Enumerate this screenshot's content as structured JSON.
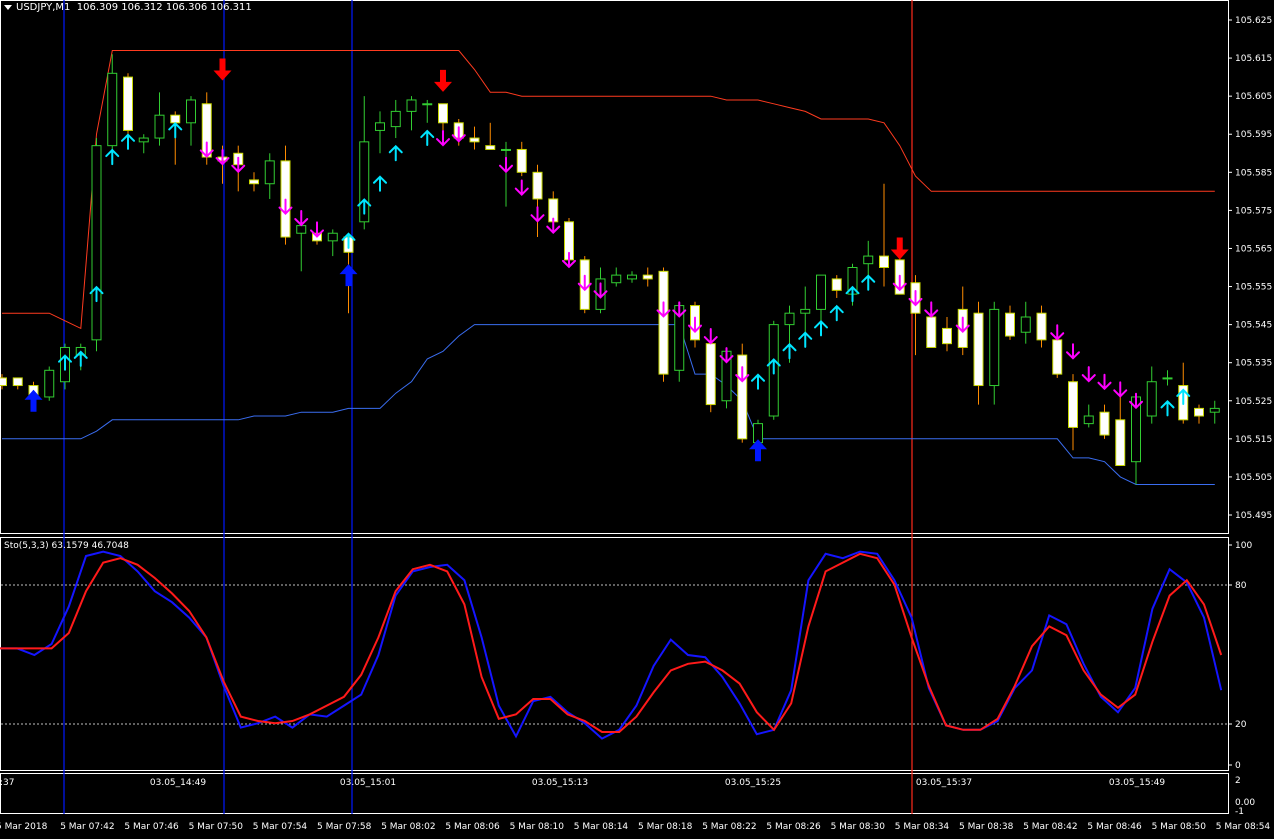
{
  "window": {
    "symbol_label": "USDJPY,M1",
    "ohlc_label": "106.309 106.312 106.306 106.311"
  },
  "indicator": {
    "label": "Sto(5,3,3) 63.1579 46.7048",
    "levels": [
      80,
      20
    ]
  },
  "colors": {
    "background": "#000000",
    "bull_candle": "#32cd32",
    "bear_candle": "#ffffff",
    "wick_up": "#32cd32",
    "wick_down": "#ff8c00",
    "upper_channel": "#ff3b1f",
    "lower_channel": "#3a6df0",
    "buy_arrow": "#00e5ff",
    "sell_arrow": "#ff00ff",
    "big_buy": "#0018ff",
    "big_sell": "#ff0000",
    "sto_main": "#1515ff",
    "sto_signal": "#ff1a1a"
  },
  "price_axis": [
    "105.625",
    "105.615",
    "105.605",
    "105.595",
    "105.585",
    "105.575",
    "105.565",
    "105.555",
    "105.545",
    "105.535",
    "105.525",
    "105.515",
    "105.505",
    "105.495"
  ],
  "sto_axis": [
    "100",
    "80",
    "20",
    "0"
  ],
  "bottom_axis": [
    "2",
    "0.00",
    "-1"
  ],
  "time_axis_top": [
    ":37",
    "03.05_14:49",
    "03.05_15:01",
    "03.05_15:13",
    "03.05_15:25",
    "03.05_15:37",
    "03.05_15:49"
  ],
  "time_axis_bottom": [
    "5 Mar 2018",
    "5 Mar 07:42",
    "5 Mar 07:46",
    "5 Mar 07:50",
    "5 Mar 07:54",
    "5 Mar 07:58",
    "5 Mar 08:02",
    "5 Mar 08:06",
    "5 Mar 08:10",
    "5 Mar 08:14",
    "5 Mar 08:18",
    "5 Mar 08:22",
    "5 Mar 08:26",
    "5 Mar 08:30",
    "5 Mar 08:34",
    "5 Mar 08:38",
    "5 Mar 08:42",
    "5 Mar 08:46",
    "5 Mar 08:50",
    "5 Mar 08:54"
  ],
  "candles": [
    {
      "o": 105.531,
      "h": 105.532,
      "l": 105.528,
      "c": 105.529
    },
    {
      "o": 105.531,
      "h": 105.531,
      "l": 105.528,
      "c": 105.529
    },
    {
      "o": 105.529,
      "h": 105.53,
      "l": 105.524,
      "c": 105.526
    },
    {
      "o": 105.526,
      "h": 105.534,
      "l": 105.525,
      "c": 105.533
    },
    {
      "o": 105.53,
      "h": 105.54,
      "l": 105.528,
      "c": 105.539
    },
    {
      "o": 105.537,
      "h": 105.54,
      "l": 105.533,
      "c": 105.539
    },
    {
      "o": 105.541,
      "h": 105.594,
      "l": 105.538,
      "c": 105.592
    },
    {
      "o": 105.592,
      "h": 105.616,
      "l": 105.588,
      "c": 105.611
    },
    {
      "o": 105.61,
      "h": 105.611,
      "l": 105.594,
      "c": 105.596
    },
    {
      "o": 105.593,
      "h": 105.595,
      "l": 105.59,
      "c": 105.594
    },
    {
      "o": 105.594,
      "h": 105.606,
      "l": 105.592,
      "c": 105.6
    },
    {
      "o": 105.6,
      "h": 105.601,
      "l": 105.587,
      "c": 105.598
    },
    {
      "o": 105.598,
      "h": 105.605,
      "l": 105.592,
      "c": 105.604
    },
    {
      "o": 105.603,
      "h": 105.606,
      "l": 105.587,
      "c": 105.589
    },
    {
      "o": 105.589,
      "h": 105.592,
      "l": 105.582,
      "c": 105.588
    },
    {
      "o": 105.59,
      "h": 105.592,
      "l": 105.58,
      "c": 105.587
    },
    {
      "o": 105.583,
      "h": 105.585,
      "l": 105.58,
      "c": 105.582
    },
    {
      "o": 105.582,
      "h": 105.59,
      "l": 105.578,
      "c": 105.588
    },
    {
      "o": 105.588,
      "h": 105.592,
      "l": 105.566,
      "c": 105.568
    },
    {
      "o": 105.569,
      "h": 105.573,
      "l": 105.559,
      "c": 105.571
    },
    {
      "o": 105.569,
      "h": 105.571,
      "l": 105.566,
      "c": 105.567
    },
    {
      "o": 105.567,
      "h": 105.57,
      "l": 105.563,
      "c": 105.569
    },
    {
      "o": 105.568,
      "h": 105.569,
      "l": 105.548,
      "c": 105.564
    },
    {
      "o": 105.572,
      "h": 105.605,
      "l": 105.57,
      "c": 105.593
    },
    {
      "o": 105.596,
      "h": 105.601,
      "l": 105.59,
      "c": 105.598
    },
    {
      "o": 105.597,
      "h": 105.604,
      "l": 105.594,
      "c": 105.601
    },
    {
      "o": 105.601,
      "h": 105.605,
      "l": 105.596,
      "c": 105.604
    },
    {
      "o": 105.603,
      "h": 105.604,
      "l": 105.598,
      "c": 105.603
    },
    {
      "o": 105.603,
      "h": 105.603,
      "l": 105.595,
      "c": 105.598
    },
    {
      "o": 105.598,
      "h": 105.599,
      "l": 105.592,
      "c": 105.594
    },
    {
      "o": 105.594,
      "h": 105.597,
      "l": 105.591,
      "c": 105.593
    },
    {
      "o": 105.592,
      "h": 105.598,
      "l": 105.591,
      "c": 105.591
    },
    {
      "o": 105.591,
      "h": 105.593,
      "l": 105.576,
      "c": 105.591
    },
    {
      "o": 105.591,
      "h": 105.593,
      "l": 105.584,
      "c": 105.585
    },
    {
      "o": 105.585,
      "h": 105.587,
      "l": 105.568,
      "c": 105.578
    },
    {
      "o": 105.578,
      "h": 105.58,
      "l": 105.571,
      "c": 105.572
    },
    {
      "o": 105.572,
      "h": 105.573,
      "l": 105.56,
      "c": 105.562
    },
    {
      "o": 105.562,
      "h": 105.563,
      "l": 105.548,
      "c": 105.549
    },
    {
      "o": 105.549,
      "h": 105.56,
      "l": 105.548,
      "c": 105.557
    },
    {
      "o": 105.556,
      "h": 105.56,
      "l": 105.555,
      "c": 105.558
    },
    {
      "o": 105.557,
      "h": 105.559,
      "l": 105.556,
      "c": 105.558
    },
    {
      "o": 105.558,
      "h": 105.56,
      "l": 105.555,
      "c": 105.557
    },
    {
      "o": 105.559,
      "h": 105.56,
      "l": 105.53,
      "c": 105.532
    },
    {
      "o": 105.533,
      "h": 105.551,
      "l": 105.53,
      "c": 105.55
    },
    {
      "o": 105.55,
      "h": 105.551,
      "l": 105.539,
      "c": 105.541
    },
    {
      "o": 105.54,
      "h": 105.541,
      "l": 105.522,
      "c": 105.524
    },
    {
      "o": 105.525,
      "h": 105.539,
      "l": 105.523,
      "c": 105.538
    },
    {
      "o": 105.537,
      "h": 105.54,
      "l": 105.514,
      "c": 105.515
    },
    {
      "o": 105.514,
      "h": 105.52,
      "l": 105.514,
      "c": 105.519
    },
    {
      "o": 105.521,
      "h": 105.546,
      "l": 105.52,
      "c": 105.545
    },
    {
      "o": 105.545,
      "h": 105.55,
      "l": 105.535,
      "c": 105.548
    },
    {
      "o": 105.548,
      "h": 105.555,
      "l": 105.542,
      "c": 105.549
    },
    {
      "o": 105.549,
      "h": 105.558,
      "l": 105.545,
      "c": 105.558
    },
    {
      "o": 105.557,
      "h": 105.558,
      "l": 105.552,
      "c": 105.554
    },
    {
      "o": 105.553,
      "h": 105.561,
      "l": 105.55,
      "c": 105.56
    },
    {
      "o": 105.561,
      "h": 105.567,
      "l": 105.555,
      "c": 105.563
    },
    {
      "o": 105.563,
      "h": 105.582,
      "l": 105.555,
      "c": 105.56
    },
    {
      "o": 105.562,
      "h": 105.566,
      "l": 105.553,
      "c": 105.553
    },
    {
      "o": 105.556,
      "h": 105.558,
      "l": 105.537,
      "c": 105.548
    },
    {
      "o": 105.547,
      "h": 105.548,
      "l": 105.539,
      "c": 105.539
    },
    {
      "o": 105.544,
      "h": 105.547,
      "l": 105.538,
      "c": 105.54
    },
    {
      "o": 105.549,
      "h": 105.555,
      "l": 105.537,
      "c": 105.539
    },
    {
      "o": 105.548,
      "h": 105.551,
      "l": 105.524,
      "c": 105.529
    },
    {
      "o": 105.529,
      "h": 105.551,
      "l": 105.524,
      "c": 105.549
    },
    {
      "o": 105.548,
      "h": 105.55,
      "l": 105.541,
      "c": 105.542
    },
    {
      "o": 105.543,
      "h": 105.551,
      "l": 105.54,
      "c": 105.547
    },
    {
      "o": 105.548,
      "h": 105.55,
      "l": 105.539,
      "c": 105.541
    },
    {
      "o": 105.541,
      "h": 105.542,
      "l": 105.531,
      "c": 105.532
    },
    {
      "o": 105.53,
      "h": 105.532,
      "l": 105.512,
      "c": 105.518
    },
    {
      "o": 105.519,
      "h": 105.524,
      "l": 105.518,
      "c": 105.521
    },
    {
      "o": 105.522,
      "h": 105.524,
      "l": 105.515,
      "c": 105.516
    },
    {
      "o": 105.52,
      "h": 105.53,
      "l": 105.509,
      "c": 105.508
    },
    {
      "o": 105.509,
      "h": 105.527,
      "l": 105.503,
      "c": 105.526
    },
    {
      "o": 105.521,
      "h": 105.534,
      "l": 105.519,
      "c": 105.53
    },
    {
      "o": 105.531,
      "h": 105.533,
      "l": 105.529,
      "c": 105.531
    },
    {
      "o": 105.529,
      "h": 105.535,
      "l": 105.519,
      "c": 105.52
    },
    {
      "o": 105.523,
      "h": 105.524,
      "l": 105.519,
      "c": 105.521
    },
    {
      "o": 105.522,
      "h": 105.525,
      "l": 105.519,
      "c": 105.523
    }
  ],
  "upper_channel": [
    105.548,
    105.548,
    105.548,
    105.548,
    105.546,
    105.544,
    105.595,
    105.617,
    105.617,
    105.617,
    105.617,
    105.617,
    105.617,
    105.617,
    105.617,
    105.617,
    105.617,
    105.617,
    105.617,
    105.617,
    105.617,
    105.617,
    105.617,
    105.617,
    105.617,
    105.617,
    105.617,
    105.617,
    105.617,
    105.617,
    105.612,
    105.606,
    105.606,
    105.605,
    105.605,
    105.605,
    105.605,
    105.605,
    105.605,
    105.605,
    105.605,
    105.605,
    105.605,
    105.605,
    105.605,
    105.605,
    105.604,
    105.604,
    105.604,
    105.603,
    105.602,
    105.601,
    105.599,
    105.599,
    105.599,
    105.599,
    105.598,
    105.592,
    105.584,
    105.58,
    105.58,
    105.58,
    105.58,
    105.58,
    105.58,
    105.58,
    105.58,
    105.58,
    105.58,
    105.58,
    105.58,
    105.58,
    105.58,
    105.58,
    105.58,
    105.58,
    105.58,
    105.58
  ],
  "lower_channel": [
    105.515,
    105.515,
    105.515,
    105.515,
    105.515,
    105.515,
    105.517,
    105.52,
    105.52,
    105.52,
    105.52,
    105.52,
    105.52,
    105.52,
    105.52,
    105.52,
    105.521,
    105.521,
    105.521,
    105.522,
    105.522,
    105.522,
    105.523,
    105.523,
    105.523,
    105.527,
    105.53,
    105.536,
    105.538,
    105.542,
    105.545,
    105.545,
    105.545,
    105.545,
    105.545,
    105.545,
    105.545,
    105.545,
    105.545,
    105.545,
    105.545,
    105.545,
    105.545,
    105.545,
    105.532,
    105.532,
    105.529,
    105.525,
    105.515,
    105.515,
    105.515,
    105.515,
    105.515,
    105.515,
    105.515,
    105.515,
    105.515,
    105.515,
    105.515,
    105.515,
    105.515,
    105.515,
    105.515,
    105.515,
    105.515,
    105.515,
    105.515,
    105.515,
    105.51,
    105.51,
    105.509,
    105.505,
    105.503,
    105.503,
    105.503,
    105.503,
    105.503,
    105.503
  ],
  "buy_arrows": [
    {
      "i": 4,
      "p": 105.535
    },
    {
      "i": 5,
      "p": 105.536
    },
    {
      "i": 6,
      "p": 105.553
    },
    {
      "i": 7,
      "p": 105.589
    },
    {
      "i": 8,
      "p": 105.593
    },
    {
      "i": 11,
      "p": 105.596
    },
    {
      "i": 22,
      "p": 105.567
    },
    {
      "i": 23,
      "p": 105.576
    },
    {
      "i": 24,
      "p": 105.582
    },
    {
      "i": 25,
      "p": 105.59
    },
    {
      "i": 27,
      "p": 105.594
    },
    {
      "i": 48,
      "p": 105.53
    },
    {
      "i": 49,
      "p": 105.534
    },
    {
      "i": 50,
      "p": 105.538
    },
    {
      "i": 51,
      "p": 105.541
    },
    {
      "i": 52,
      "p": 105.544
    },
    {
      "i": 53,
      "p": 105.548
    },
    {
      "i": 54,
      "p": 105.553
    },
    {
      "i": 55,
      "p": 105.556
    },
    {
      "i": 74,
      "p": 105.523
    },
    {
      "i": 75,
      "p": 105.526
    }
  ],
  "sell_arrows": [
    {
      "i": 13,
      "p": 105.591
    },
    {
      "i": 14,
      "p": 105.589
    },
    {
      "i": 15,
      "p": 105.587
    },
    {
      "i": 18,
      "p": 105.576
    },
    {
      "i": 19,
      "p": 105.573
    },
    {
      "i": 20,
      "p": 105.57
    },
    {
      "i": 28,
      "p": 105.594
    },
    {
      "i": 29,
      "p": 105.595
    },
    {
      "i": 32,
      "p": 105.587
    },
    {
      "i": 33,
      "p": 105.581
    },
    {
      "i": 34,
      "p": 105.574
    },
    {
      "i": 35,
      "p": 105.571
    },
    {
      "i": 36,
      "p": 105.562
    },
    {
      "i": 37,
      "p": 105.556
    },
    {
      "i": 38,
      "p": 105.554
    },
    {
      "i": 42,
      "p": 105.549
    },
    {
      "i": 43,
      "p": 105.549
    },
    {
      "i": 44,
      "p": 105.545
    },
    {
      "i": 45,
      "p": 105.542
    },
    {
      "i": 46,
      "p": 105.537
    },
    {
      "i": 47,
      "p": 105.532
    },
    {
      "i": 57,
      "p": 105.556
    },
    {
      "i": 58,
      "p": 105.552
    },
    {
      "i": 59,
      "p": 105.549
    },
    {
      "i": 61,
      "p": 105.545
    },
    {
      "i": 67,
      "p": 105.543
    },
    {
      "i": 68,
      "p": 105.538
    },
    {
      "i": 69,
      "p": 105.532
    },
    {
      "i": 70,
      "p": 105.53
    },
    {
      "i": 71,
      "p": 105.528
    },
    {
      "i": 72,
      "p": 105.525
    }
  ],
  "big_buy_arrows": [
    {
      "i": 2,
      "p": 105.525
    },
    {
      "i": 22,
      "p": 105.558
    },
    {
      "i": 48,
      "p": 105.512
    }
  ],
  "big_sell_arrows": [
    {
      "i": 14,
      "p": 105.612
    },
    {
      "i": 28,
      "p": 105.609
    },
    {
      "i": 57,
      "p": 105.565
    }
  ],
  "sto_main": [
    53,
    53,
    50,
    55,
    72,
    95,
    97,
    95,
    88,
    79,
    74,
    67,
    58,
    36,
    17,
    19,
    22,
    17,
    23,
    22,
    27,
    32,
    50,
    77,
    88,
    90,
    91,
    84,
    58,
    27,
    13,
    29,
    31,
    24,
    19,
    12,
    16,
    27,
    45,
    57,
    50,
    49,
    40,
    28,
    14,
    16,
    34,
    84,
    96,
    94,
    97,
    96,
    84,
    67,
    35,
    18,
    16,
    16,
    20,
    35,
    43,
    68,
    64,
    46,
    31,
    24,
    35,
    71,
    89,
    83,
    67,
    34
  ],
  "sto_signal": [
    53,
    53,
    53,
    53,
    60,
    79,
    92,
    94,
    91,
    85,
    78,
    70,
    58,
    38,
    22,
    20,
    19,
    20,
    23,
    27,
    31,
    41,
    58,
    79,
    89,
    91,
    88,
    73,
    40,
    21,
    23,
    30,
    30,
    23,
    20,
    15,
    15,
    22,
    33,
    43,
    46,
    47,
    43,
    37,
    24,
    16,
    28,
    63,
    88,
    92,
    96,
    94,
    82,
    58,
    36,
    18,
    16,
    16,
    21,
    36,
    54,
    63,
    59,
    43,
    32,
    26,
    32,
    56,
    77,
    84,
    73,
    50
  ]
}
